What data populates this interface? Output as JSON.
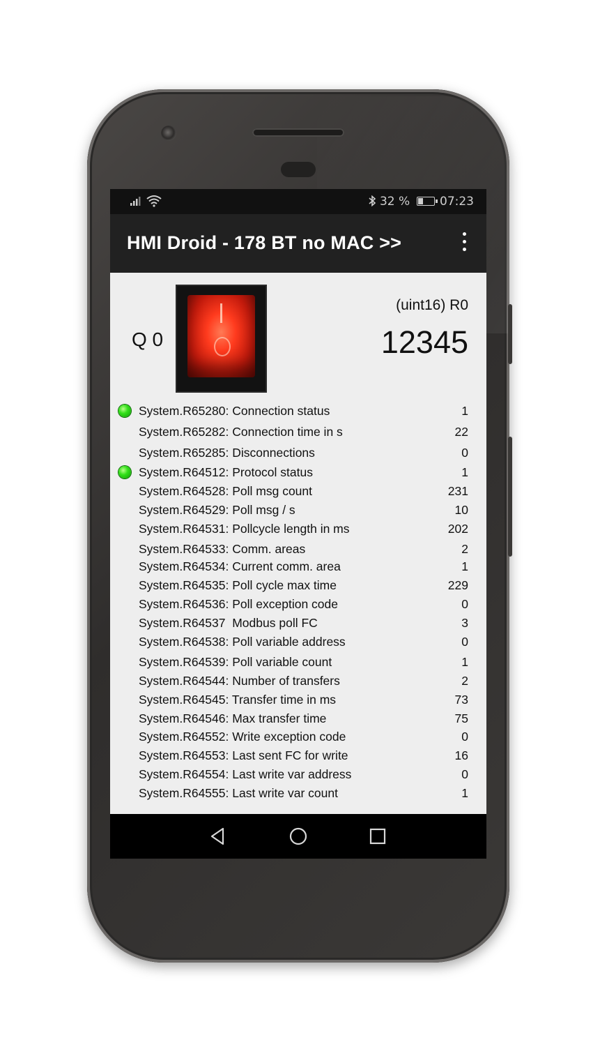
{
  "status_bar": {
    "signal_icon": "signal-bars-icon",
    "wifi_icon": "wifi-icon",
    "bluetooth_icon": "bluetooth-icon",
    "battery_text": "32 %",
    "battery_level": 0.32,
    "time": "07:23"
  },
  "app_bar": {
    "title": "HMI Droid - 178 BT no MAC >>",
    "menu_icon": "more-vert-icon"
  },
  "top_panel": {
    "switch_label": "Q 0",
    "switch_state": "on",
    "register_type": "(uint16) R0",
    "register_value": "12345"
  },
  "registers": [
    {
      "label": "System.R65280: Connection status",
      "value": "1",
      "led": true
    },
    {
      "label": "System.R65282: Connection time in s",
      "value": "22",
      "led": false
    },
    {
      "label": "System.R65285: Disconnections",
      "value": "0",
      "led": false
    },
    {
      "label": "System.R64512: Protocol status",
      "value": "1",
      "led": true
    },
    {
      "label": "System.R64528: Poll msg count",
      "value": "231",
      "led": false
    },
    {
      "label": "System.R64529: Poll msg / s",
      "value": "10",
      "led": false
    },
    {
      "label": "System.R64531: Pollcycle length in ms",
      "value": "202",
      "led": false
    },
    {
      "label": "System.R64533: Comm. areas",
      "value": "2",
      "led": false
    },
    {
      "label": "System.R64534: Current comm. area",
      "value": "1",
      "led": false
    },
    {
      "label": "System.R64535: Poll cycle max time",
      "value": "229",
      "led": false
    },
    {
      "label": "System.R64536: Poll exception code",
      "value": "0",
      "led": false
    },
    {
      "label": "System.R64537  Modbus poll FC",
      "value": "3",
      "led": false
    },
    {
      "label": "System.R64538: Poll variable address",
      "value": "0",
      "led": false
    },
    {
      "label": "System.R64539: Poll variable count",
      "value": "1",
      "led": false
    },
    {
      "label": "System.R64544: Number of transfers",
      "value": "2",
      "led": false
    },
    {
      "label": "System.R64545: Transfer time in ms",
      "value": "73",
      "led": false
    },
    {
      "label": "System.R64546: Max transfer time",
      "value": "75",
      "led": false
    },
    {
      "label": "System.R64552: Write exception code",
      "value": "0",
      "led": false
    },
    {
      "label": "System.R64553: Last sent FC for write",
      "value": "16",
      "led": false
    },
    {
      "label": "System.R64554: Last write var address",
      "value": "0",
      "led": false
    },
    {
      "label": "System.R64555: Last write var count",
      "value": "1",
      "led": false
    }
  ],
  "nav_bar": {
    "back_icon": "back-triangle-icon",
    "home_icon": "home-circle-icon",
    "recent_icon": "recents-square-icon"
  }
}
